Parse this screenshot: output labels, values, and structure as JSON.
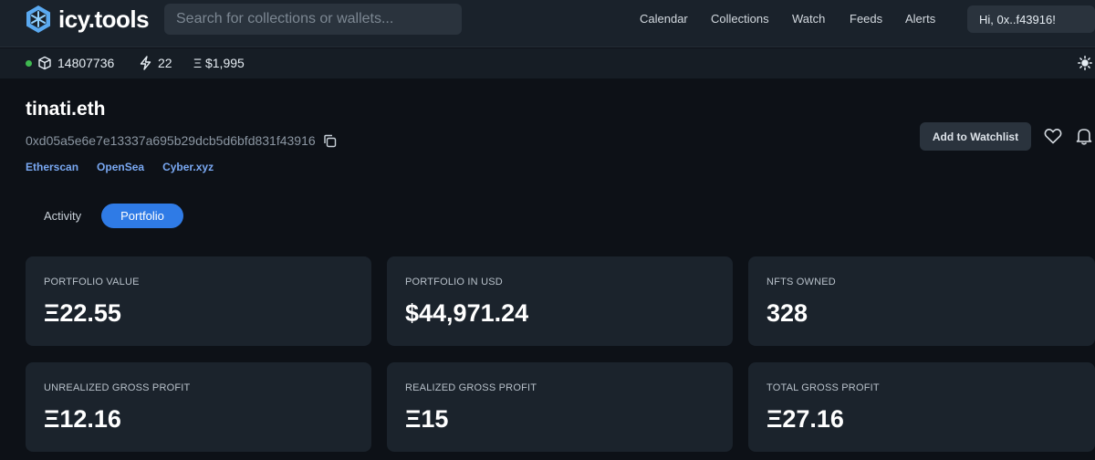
{
  "header": {
    "logo_text": "icy.tools",
    "search_placeholder": "Search for collections or wallets...",
    "nav": [
      "Calendar",
      "Collections",
      "Watch",
      "Feeds",
      "Alerts"
    ],
    "user_greeting": "Hi, 0x..f43916!"
  },
  "stats": {
    "block": "14807736",
    "gas": "22",
    "eth_price": "Ξ $1,995"
  },
  "profile": {
    "name": "tinati.eth",
    "address": "0xd05a5e6e7e13337a695b29dcb5d6bfd831f43916",
    "links": [
      "Etherscan",
      "OpenSea",
      "Cyber.xyz"
    ],
    "watchlist_label": "Add to Watchlist"
  },
  "tabs": {
    "activity": "Activity",
    "portfolio": "Portfolio"
  },
  "cards": [
    {
      "label": "PORTFOLIO VALUE",
      "value": "Ξ22.55"
    },
    {
      "label": "PORTFOLIO IN USD",
      "value": "$44,971.24"
    },
    {
      "label": "NFTS OWNED",
      "value": "328"
    },
    {
      "label": "UNREALIZED GROSS PROFIT",
      "value": "Ξ12.16"
    },
    {
      "label": "REALIZED GROSS PROFIT",
      "value": "Ξ15"
    },
    {
      "label": "TOTAL GROSS PROFIT",
      "value": "Ξ27.16"
    }
  ],
  "colors": {
    "accent": "#2f7be6",
    "link": "#79a8f2",
    "status_green": "#3fb950",
    "background": "#0d1117",
    "card": "#1b232c"
  }
}
